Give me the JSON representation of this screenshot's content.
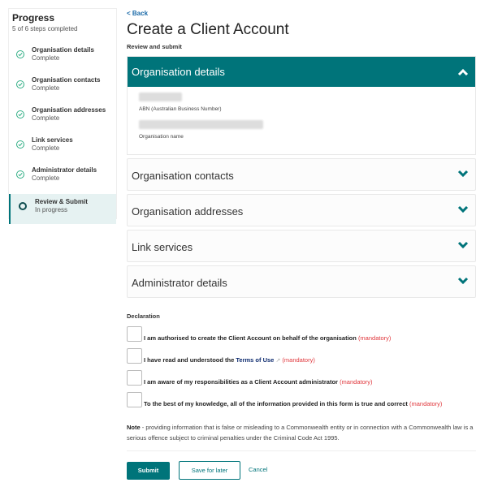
{
  "sidebar": {
    "title": "Progress",
    "subtitle": "5 of 6 steps completed",
    "steps": [
      {
        "label": "Organisation details",
        "status": "Complete",
        "icon": "check-circle-icon"
      },
      {
        "label": "Organisation contacts",
        "status": "Complete",
        "icon": "check-circle-icon"
      },
      {
        "label": "Organisation addresses",
        "status": "Complete",
        "icon": "check-circle-icon"
      },
      {
        "label": "Link services",
        "status": "Complete",
        "icon": "check-circle-icon"
      },
      {
        "label": "Administrator details",
        "status": "Complete",
        "icon": "check-circle-icon"
      },
      {
        "label": "Review & Submit",
        "status": "In progress",
        "icon": "circle-icon"
      }
    ]
  },
  "main": {
    "back_label": "< Back",
    "title": "Create a Client Account",
    "subtitle": "Review and submit",
    "sections": [
      {
        "title": "Organisation details",
        "expanded": true,
        "fields": [
          {
            "label": "ABN (Australian Business Number)",
            "value": "[redacted]"
          },
          {
            "label": "Organisation name",
            "value": "[redacted]"
          }
        ]
      },
      {
        "title": "Organisation contacts",
        "expanded": false
      },
      {
        "title": "Organisation addresses",
        "expanded": false
      },
      {
        "title": "Link services",
        "expanded": false
      },
      {
        "title": "Administrator details",
        "expanded": false
      }
    ],
    "declaration": {
      "title": "Declaration",
      "mandatory_label": "(mandatory)",
      "items": [
        {
          "text": "I am authorised to create the Client Account on behalf of the organisation",
          "checked": false
        },
        {
          "text_before": "I have read and understood the",
          "link": "Terms of Use",
          "checked": false
        },
        {
          "text": "I am aware of my responsibilities as a Client Account administrator",
          "checked": false
        },
        {
          "text": "To the best of my knowledge, all of the information provided in this form is true and correct",
          "checked": false
        }
      ]
    },
    "note": {
      "bold": "Note",
      "text": " - providing information that is false or misleading to a Commonwealth entity or in connection with a Commonwealth law is a serious offence subject to criminal penalties under the Criminal Code Act 1995."
    },
    "buttons": {
      "submit": "Submit",
      "save": "Save for later",
      "cancel": "Cancel"
    }
  },
  "colors": {
    "primary": "#00747a",
    "complete": "#2fae84",
    "mandatory": "#e0373c",
    "link": "#1a6aa8"
  }
}
